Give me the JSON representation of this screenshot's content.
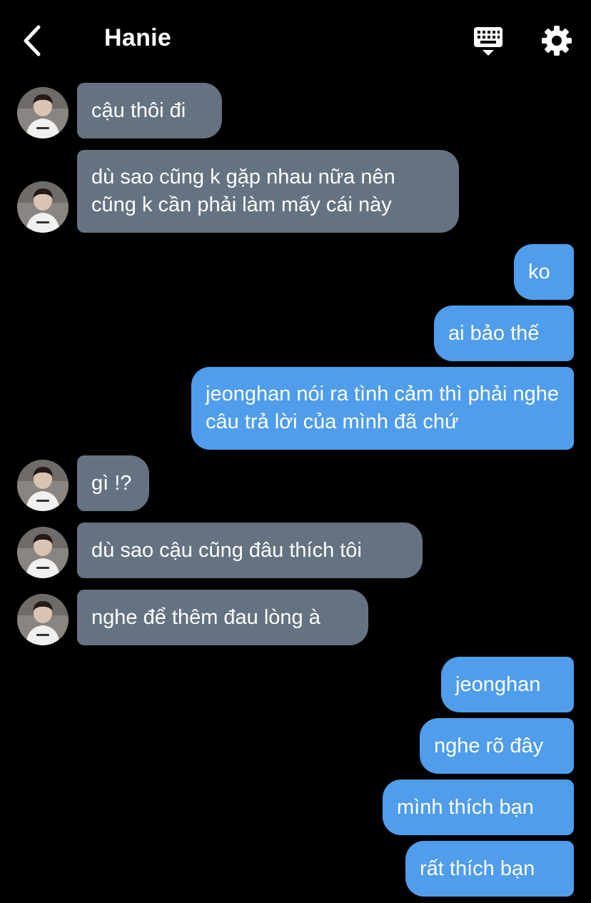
{
  "header": {
    "title": "Hanie"
  },
  "icons": {
    "back": "chevron-left-icon",
    "keyboard": "keyboard-icon",
    "settings": "gear-icon"
  },
  "colors": {
    "incoming_bubble": "#657281",
    "outgoing_bubble": "#4f9deb",
    "background": "#000000"
  },
  "messages": [
    {
      "sender": "Hanie",
      "text": "cậu thôi đi"
    },
    {
      "sender": "Hanie",
      "text": "dù sao cũng k gặp nhau nữa nên cũng k cần phải làm mấy cái này"
    },
    {
      "sender": "me",
      "text": "ko"
    },
    {
      "sender": "me",
      "text": "ai bảo thế"
    },
    {
      "sender": "me",
      "text": "jeonghan nói ra tình cảm thì phải nghe câu trả lời của mình đã chứ"
    },
    {
      "sender": "Hanie",
      "text": "gì !?"
    },
    {
      "sender": "Hanie",
      "text": "dù sao cậu cũng đâu thích tôi"
    },
    {
      "sender": "Hanie",
      "text": "nghe để thêm đau lòng à"
    },
    {
      "sender": "me",
      "text": "jeonghan"
    },
    {
      "sender": "me",
      "text": "nghe rõ đây"
    },
    {
      "sender": "me",
      "text": "mình thích bạn"
    },
    {
      "sender": "me",
      "text": "rất thích bạn"
    }
  ]
}
